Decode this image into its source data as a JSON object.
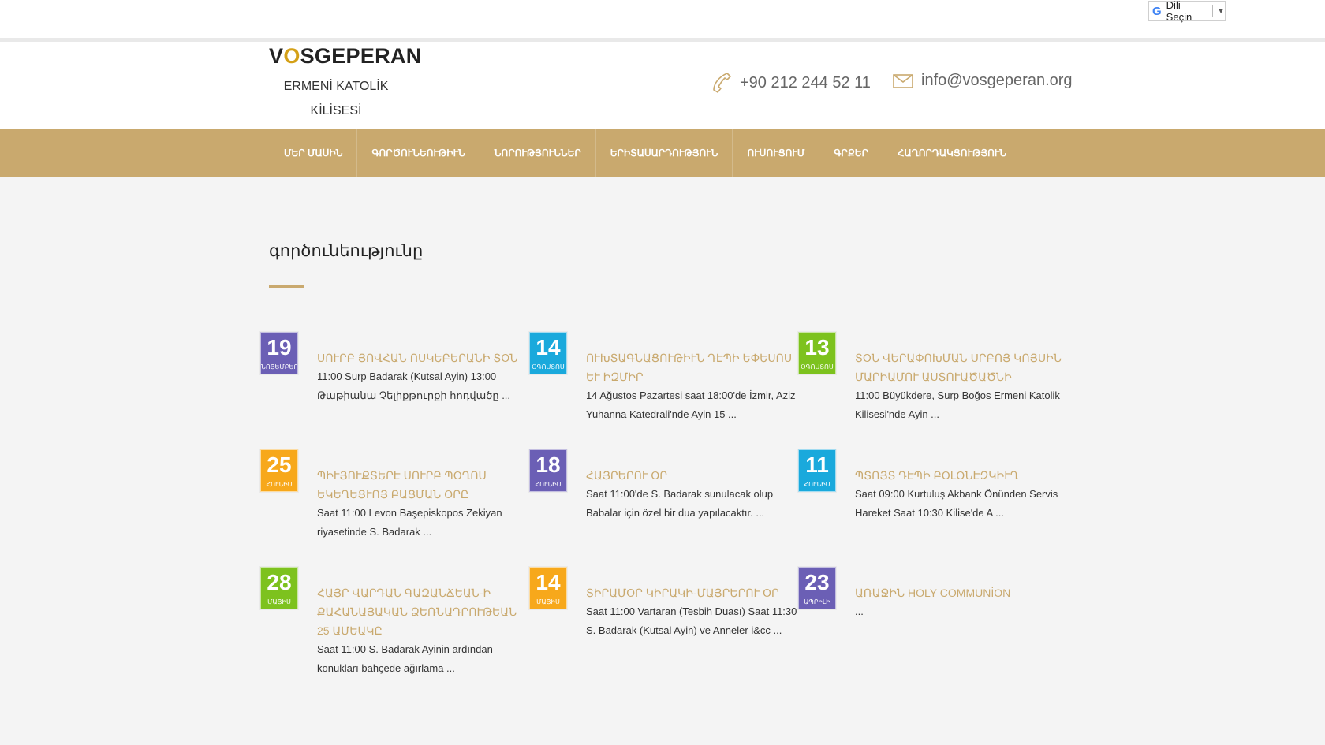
{
  "translate": {
    "label": "Dili Seçin",
    "arrow": "▼"
  },
  "logo": {
    "title_v": "V",
    "title_o": "O",
    "title_rest": "SGEPERAN",
    "subtitle_line1": "ERMENİ KATOLİK",
    "subtitle_line2": "KİLİSESİ"
  },
  "contact": {
    "phone": "+90 212 244 52 11",
    "email": "info@vosgeperan.org"
  },
  "nav": [
    "ՄԵՐ ՄԱՍԻՆ",
    "ԳՈՐԾՈՒՆԵՈՒԹԻՒՆ",
    "ՆՈՐՈՒԹՅՈՒՆՆԵՐ",
    "ԵՐԻՏԱՍԱՐԴՈՒԹՅՈՒՆ",
    "ՈՒՍՈՒՑՈՒՄ",
    "ԳՐՔԵՐ",
    "ՀԱՂՈՐԴԱԿՑՈՒԹՅՈՒՆ"
  ],
  "page_title": "գործունեությունը",
  "colors": {
    "accent": "#c9a96e",
    "purple": "#6b5fb5",
    "blue": "#1aa9dc",
    "green": "#7dc21e",
    "orange": "#f7a81b"
  },
  "events": [
    {
      "day": "19",
      "month": "ՆՈՅԵՄԲԵՐ",
      "color": "#6b5fb5",
      "title": "ՍՈՒՐԲ ՅՈՎՀԱՆ ՈՍԿԵԲԵՐԱՆԻ ՏՕՆ",
      "text": "11:00 Surp Badarak (Kutsal Ayin) 13:00 Թաթիանա Չելիքթուրքի հոդվածը ..."
    },
    {
      "day": "14",
      "month": "ՕԳՈՍՏՈՍ",
      "color": "#1aa9dc",
      "title": "ՈՒԽՏԱԳՆԱՑՈՒԹԻՒՆ ԴԷՊԻ ԵՓԵՍՈՍ ԵՒ ԻԶՄԻՐ",
      "text": "14 Ağustos Pazartesi saat 18:00'de İzmir, Aziz Yuhanna Katedrali'nde Ayin 15 ..."
    },
    {
      "day": "13",
      "month": "ՕԳՈՍՏՈՍ",
      "color": "#7dc21e",
      "title": "ՏՕՆ ՎԵՐԱՓՈԽՄԱՆ ՍՐԲՈՅ ԿՈՅՍԻՆ ՄԱՐԻԱՄՈՒ ԱՍՏՈՒԱԾԱԾՆԻ",
      "text": "11:00 Büyükdere, Surp Boğos Ermeni Katolik Kilisesi'nde Ayin ..."
    },
    {
      "day": "25",
      "month": "ՀՈՒՆԻՍ",
      "color": "#f7a81b",
      "title": "ՊԻՒՅՈՒՔՏԵՐԷ ՍՈՒՐԲ ՊՕՂՈՍ ԵԿԵՂԵՑՒՈՅ ԲԱՑՄԱՆ ՕՐԸ",
      "text": "Saat 11:00 Levon Başepiskopos Zekiyan riyasetinde S. Badarak ..."
    },
    {
      "day": "18",
      "month": "ՀՈՒՆԻՍ",
      "color": "#6b5fb5",
      "title": "ՀԱՅՐԵՐՈՒ ՕՐ",
      "text": "Saat 11:00'de S. Badarak sunulacak olup Babalar için özel bir dua yapılacaktır. ..."
    },
    {
      "day": "11",
      "month": "ՀՈՒՆԻՍ",
      "color": "#1aa9dc",
      "title": "ՊՏՈՅՏ ԴԷՊԻ ԲՕԼՕՆԷԶԿԻՒՂ",
      "text": "Saat 09:00 Kurtuluş Akbank Önünden Servis Hareket Saat 10:30 Kilise'de A ..."
    },
    {
      "day": "28",
      "month": "ՄԱՅԻՍ",
      "color": "#7dc21e",
      "title": "ՀԱՅՐ ՎԱՐԴԱՆ ԳԱԶԱՆՃԵԱՆ-Ի ՔԱՀԱՆԱՅԱԿԱՆ ՁԵՌՆԱԴՐՈՒԹԵԱՆ 25 ԱՄԵԱԿԸ",
      "text": "Saat 11:00 S. Badarak Ayinin ardından konukları bahçede ağırlama ..."
    },
    {
      "day": "14",
      "month": "ՄԱՅԻՍ",
      "color": "#f7a81b",
      "title": "ՏԻՐԱՄՕՐ ԿԻՐԱԿԻ-ՄԱՅՐԵՐՈՒ ՕՐ",
      "text": "Saat 11:00 Vartaran (Tesbih Duası) Saat 11:30 S. Badarak (Kutsal Ayin) ve Anneler i&cc ..."
    },
    {
      "day": "23",
      "month": "ԱՊՐԻԼԻ",
      "color": "#6b5fb5",
      "title": "ԱՌԱՋԻՆ HOLY COMMUNİON",
      "text": "..."
    }
  ]
}
